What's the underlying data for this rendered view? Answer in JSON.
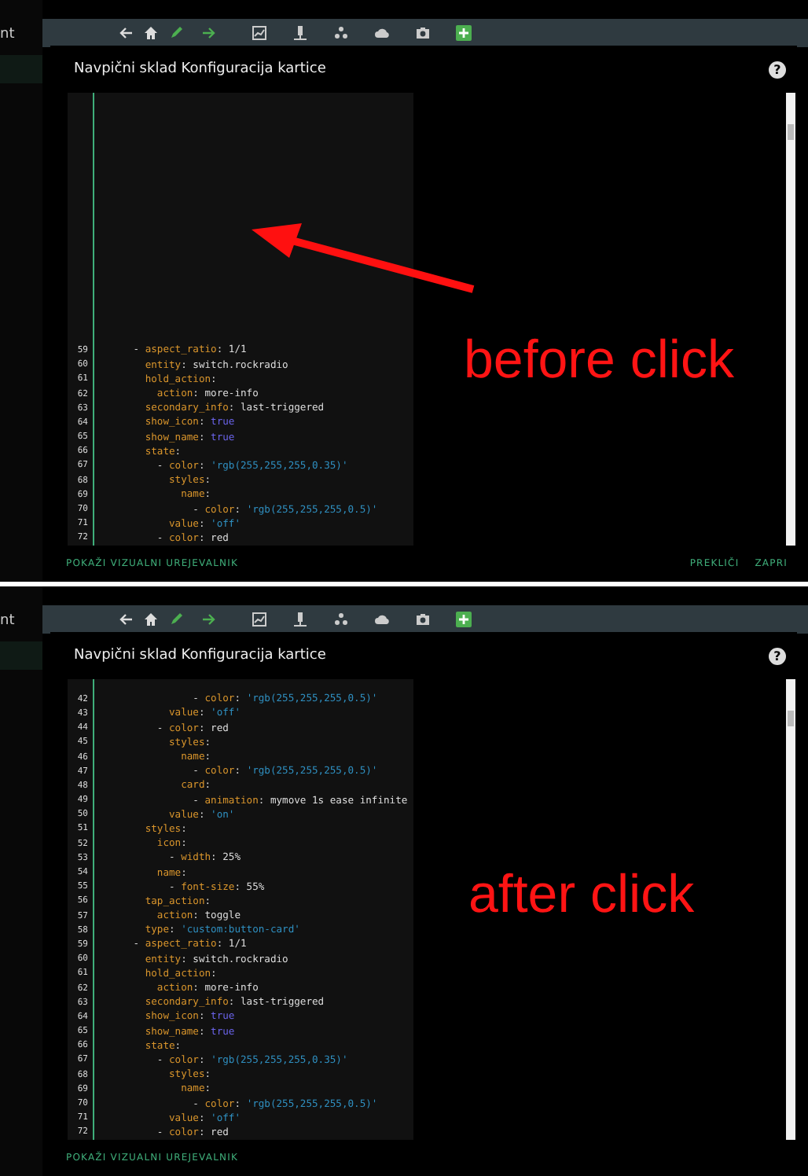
{
  "panels": [
    {
      "sidebar_text": "nt",
      "dialog": {
        "title": "Navpični sklad Konfiguracija kartice",
        "help": "?",
        "footer_left": "POKAŽI VIZUALNI UREJEVALNIK",
        "footer_right": [
          "PREKLIČI",
          "ZAPRI"
        ]
      },
      "code_lines": [
        {
          "num": "59",
          "parts": [
            {
              "kind": "plain",
              "text": "      - "
            },
            {
              "kind": "key",
              "text": "aspect_ratio"
            },
            {
              "kind": "plain",
              "text": ": 1/1"
            }
          ]
        },
        {
          "num": "60",
          "parts": [
            {
              "kind": "key",
              "text": "        entity"
            },
            {
              "kind": "plain",
              "text": ": switch.rockradio"
            }
          ]
        },
        {
          "num": "61",
          "parts": [
            {
              "kind": "key",
              "text": "        hold_action"
            },
            {
              "kind": "plain",
              "text": ":"
            }
          ]
        },
        {
          "num": "62",
          "parts": [
            {
              "kind": "key",
              "text": "          action"
            },
            {
              "kind": "plain",
              "text": ": more-info"
            }
          ]
        },
        {
          "num": "63",
          "parts": [
            {
              "kind": "key",
              "text": "        secondary_info"
            },
            {
              "kind": "plain",
              "text": ": last-triggered"
            }
          ]
        },
        {
          "num": "64",
          "parts": [
            {
              "kind": "key",
              "text": "        show_icon"
            },
            {
              "kind": "plain",
              "text": ": "
            },
            {
              "kind": "bool",
              "text": "true"
            }
          ]
        },
        {
          "num": "65",
          "parts": [
            {
              "kind": "key",
              "text": "        show_name"
            },
            {
              "kind": "plain",
              "text": ": "
            },
            {
              "kind": "bool",
              "text": "true"
            }
          ]
        },
        {
          "num": "66",
          "parts": [
            {
              "kind": "key",
              "text": "        state"
            },
            {
              "kind": "plain",
              "text": ":"
            }
          ]
        },
        {
          "num": "67",
          "parts": [
            {
              "kind": "plain",
              "text": "          - "
            },
            {
              "kind": "key",
              "text": "color"
            },
            {
              "kind": "plain",
              "text": ": "
            },
            {
              "kind": "string",
              "text": "'rgb(255,255,255,0.35)'"
            }
          ]
        },
        {
          "num": "68",
          "parts": [
            {
              "kind": "key",
              "text": "            styles"
            },
            {
              "kind": "plain",
              "text": ":"
            }
          ]
        },
        {
          "num": "69",
          "parts": [
            {
              "kind": "key",
              "text": "              name"
            },
            {
              "kind": "plain",
              "text": ":"
            }
          ]
        },
        {
          "num": "70",
          "parts": [
            {
              "kind": "plain",
              "text": "                - "
            },
            {
              "kind": "key",
              "text": "color"
            },
            {
              "kind": "plain",
              "text": ": "
            },
            {
              "kind": "string",
              "text": "'rgb(255,255,255,0.5)'"
            }
          ]
        },
        {
          "num": "71",
          "parts": [
            {
              "kind": "key",
              "text": "            value"
            },
            {
              "kind": "plain",
              "text": ": "
            },
            {
              "kind": "string",
              "text": "'off'"
            }
          ]
        },
        {
          "num": "72",
          "parts": [
            {
              "kind": "plain",
              "text": "          - "
            },
            {
              "kind": "key",
              "text": "color"
            },
            {
              "kind": "plain",
              "text": ": red"
            }
          ]
        }
      ],
      "annotation": {
        "caption": "before click",
        "arrow": true
      }
    },
    {
      "sidebar_text": "nt",
      "dialog": {
        "title": "Navpični sklad Konfiguracija kartice",
        "help": "?",
        "footer_left": "POKAŽI VIZUALNI UREJEVALNIK"
      },
      "code_lines": [
        {
          "num": "42",
          "parts": [
            {
              "kind": "plain",
              "text": "                - "
            },
            {
              "kind": "key",
              "text": "color"
            },
            {
              "kind": "plain",
              "text": ": "
            },
            {
              "kind": "string",
              "text": "'rgb(255,255,255,0.5)'"
            }
          ]
        },
        {
          "num": "43",
          "parts": [
            {
              "kind": "key",
              "text": "            value"
            },
            {
              "kind": "plain",
              "text": ": "
            },
            {
              "kind": "string",
              "text": "'off'"
            }
          ]
        },
        {
          "num": "44",
          "parts": [
            {
              "kind": "plain",
              "text": "          - "
            },
            {
              "kind": "key",
              "text": "color"
            },
            {
              "kind": "plain",
              "text": ": red"
            }
          ]
        },
        {
          "num": "45",
          "parts": [
            {
              "kind": "key",
              "text": "            styles"
            },
            {
              "kind": "plain",
              "text": ":"
            }
          ]
        },
        {
          "num": "46",
          "parts": [
            {
              "kind": "key",
              "text": "              name"
            },
            {
              "kind": "plain",
              "text": ":"
            }
          ]
        },
        {
          "num": "47",
          "parts": [
            {
              "kind": "plain",
              "text": "                - "
            },
            {
              "kind": "key",
              "text": "color"
            },
            {
              "kind": "plain",
              "text": ": "
            },
            {
              "kind": "string",
              "text": "'rgb(255,255,255,0.5)'"
            }
          ]
        },
        {
          "num": "48",
          "parts": [
            {
              "kind": "key",
              "text": "              card"
            },
            {
              "kind": "plain",
              "text": ":"
            }
          ]
        },
        {
          "num": "49",
          "parts": [
            {
              "kind": "plain",
              "text": "                - "
            },
            {
              "kind": "key",
              "text": "animation"
            },
            {
              "kind": "plain",
              "text": ": mymove 1s ease infinite"
            }
          ]
        },
        {
          "num": "50",
          "parts": [
            {
              "kind": "key",
              "text": "            value"
            },
            {
              "kind": "plain",
              "text": ": "
            },
            {
              "kind": "string",
              "text": "'on'"
            }
          ]
        },
        {
          "num": "51",
          "parts": [
            {
              "kind": "key",
              "text": "        styles"
            },
            {
              "kind": "plain",
              "text": ":"
            }
          ]
        },
        {
          "num": "52",
          "parts": [
            {
              "kind": "key",
              "text": "          icon"
            },
            {
              "kind": "plain",
              "text": ":"
            }
          ]
        },
        {
          "num": "53",
          "parts": [
            {
              "kind": "plain",
              "text": "            - "
            },
            {
              "kind": "key",
              "text": "width"
            },
            {
              "kind": "plain",
              "text": ": 25%"
            }
          ]
        },
        {
          "num": "54",
          "parts": [
            {
              "kind": "key",
              "text": "          name"
            },
            {
              "kind": "plain",
              "text": ":"
            }
          ]
        },
        {
          "num": "55",
          "parts": [
            {
              "kind": "plain",
              "text": "            - "
            },
            {
              "kind": "key",
              "text": "font-size"
            },
            {
              "kind": "plain",
              "text": ": 55%"
            }
          ]
        },
        {
          "num": "56",
          "parts": [
            {
              "kind": "key",
              "text": "        tap_action"
            },
            {
              "kind": "plain",
              "text": ":"
            }
          ]
        },
        {
          "num": "57",
          "parts": [
            {
              "kind": "key",
              "text": "          action"
            },
            {
              "kind": "plain",
              "text": ": toggle"
            }
          ]
        },
        {
          "num": "58",
          "parts": [
            {
              "kind": "key",
              "text": "        type"
            },
            {
              "kind": "plain",
              "text": ": "
            },
            {
              "kind": "string",
              "text": "'custom:button-card'"
            }
          ]
        },
        {
          "num": "59",
          "parts": [
            {
              "kind": "plain",
              "text": "      - "
            },
            {
              "kind": "key",
              "text": "aspect_ratio"
            },
            {
              "kind": "plain",
              "text": ": 1/1"
            }
          ]
        },
        {
          "num": "60",
          "parts": [
            {
              "kind": "key",
              "text": "        entity"
            },
            {
              "kind": "plain",
              "text": ": switch.rockradio"
            }
          ]
        },
        {
          "num": "61",
          "parts": [
            {
              "kind": "key",
              "text": "        hold_action"
            },
            {
              "kind": "plain",
              "text": ":"
            }
          ]
        },
        {
          "num": "62",
          "parts": [
            {
              "kind": "key",
              "text": "          action"
            },
            {
              "kind": "plain",
              "text": ": more-info"
            }
          ]
        },
        {
          "num": "63",
          "parts": [
            {
              "kind": "key",
              "text": "        secondary_info"
            },
            {
              "kind": "plain",
              "text": ": last-triggered"
            }
          ]
        },
        {
          "num": "64",
          "parts": [
            {
              "kind": "key",
              "text": "        show_icon"
            },
            {
              "kind": "plain",
              "text": ": "
            },
            {
              "kind": "bool",
              "text": "true"
            }
          ]
        },
        {
          "num": "65",
          "parts": [
            {
              "kind": "key",
              "text": "        show_name"
            },
            {
              "kind": "plain",
              "text": ": "
            },
            {
              "kind": "bool",
              "text": "true"
            }
          ]
        },
        {
          "num": "66",
          "parts": [
            {
              "kind": "key",
              "text": "        state"
            },
            {
              "kind": "plain",
              "text": ":"
            }
          ]
        },
        {
          "num": "67",
          "parts": [
            {
              "kind": "plain",
              "text": "          - "
            },
            {
              "kind": "key",
              "text": "color"
            },
            {
              "kind": "plain",
              "text": ": "
            },
            {
              "kind": "string",
              "text": "'rgb(255,255,255,0.35)'"
            }
          ]
        },
        {
          "num": "68",
          "parts": [
            {
              "kind": "key",
              "text": "            styles"
            },
            {
              "kind": "plain",
              "text": ":"
            }
          ]
        },
        {
          "num": "69",
          "parts": [
            {
              "kind": "key",
              "text": "              name"
            },
            {
              "kind": "plain",
              "text": ":"
            }
          ]
        },
        {
          "num": "70",
          "parts": [
            {
              "kind": "plain",
              "text": "                - "
            },
            {
              "kind": "key",
              "text": "color"
            },
            {
              "kind": "plain",
              "text": ": "
            },
            {
              "kind": "string",
              "text": "'rgb(255,255,255,0.5)'"
            }
          ]
        },
        {
          "num": "71",
          "parts": [
            {
              "kind": "key",
              "text": "            value"
            },
            {
              "kind": "plain",
              "text": ": "
            },
            {
              "kind": "string",
              "text": "'off'"
            }
          ]
        },
        {
          "num": "72",
          "parts": [
            {
              "kind": "plain",
              "text": "          - "
            },
            {
              "kind": "key",
              "text": "color"
            },
            {
              "kind": "plain",
              "text": ": red"
            }
          ]
        }
      ],
      "annotation": {
        "caption": "after click"
      }
    }
  ]
}
